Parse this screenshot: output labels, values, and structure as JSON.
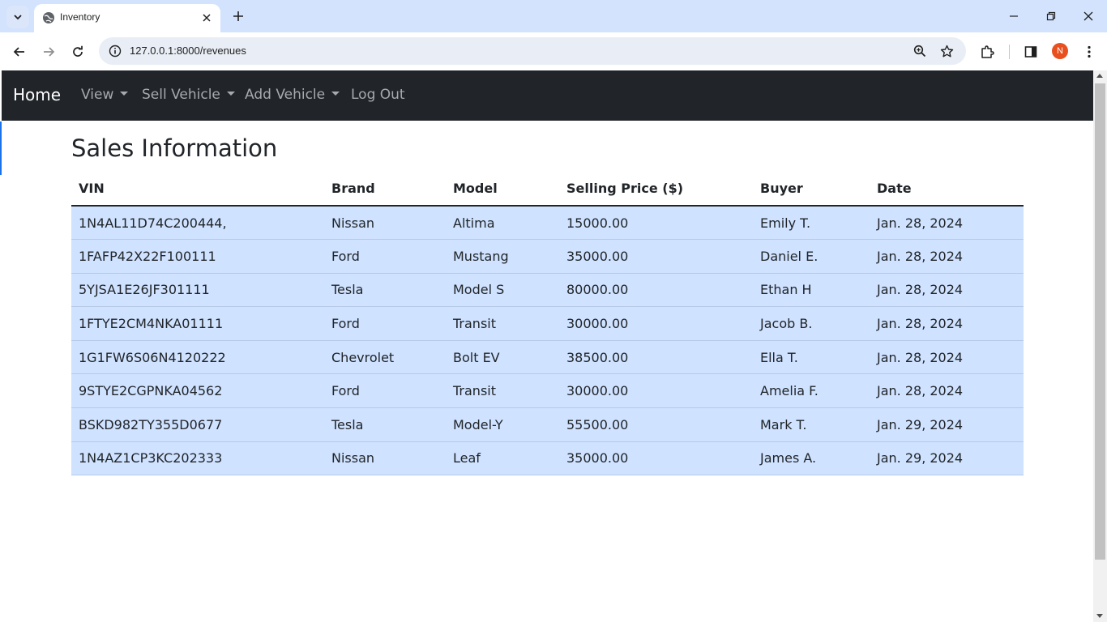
{
  "browser": {
    "tab_title": "Inventory",
    "url": "127.0.0.1:8000/revenues",
    "profile_initial": "N"
  },
  "navbar": {
    "brand": "Home",
    "items": [
      {
        "label": "View",
        "dropdown": true
      },
      {
        "label": "Sell Vehicle",
        "dropdown": true
      },
      {
        "label": "Add Vehicle",
        "dropdown": true
      },
      {
        "label": "Log Out",
        "dropdown": false
      }
    ]
  },
  "page": {
    "title": "Sales Information"
  },
  "table": {
    "headers": [
      "VIN",
      "Brand",
      "Model",
      "Selling Price ($)",
      "Buyer",
      "Date"
    ],
    "rows": [
      [
        "1N4AL11D74C200444,",
        "Nissan",
        "Altima",
        "15000.00",
        "Emily T.",
        "Jan. 28, 2024"
      ],
      [
        "1FAFP42X22F100111",
        "Ford",
        "Mustang",
        "35000.00",
        "Daniel E.",
        "Jan. 28, 2024"
      ],
      [
        "5YJSA1E26JF301111",
        "Tesla",
        "Model S",
        "80000.00",
        "Ethan H",
        "Jan. 28, 2024"
      ],
      [
        "1FTYE2CM4NKA01111",
        "Ford",
        "Transit",
        "30000.00",
        "Jacob B.",
        "Jan. 28, 2024"
      ],
      [
        "1G1FW6S06N4120222",
        "Chevrolet",
        "Bolt EV",
        "38500.00",
        "Ella T.",
        "Jan. 28, 2024"
      ],
      [
        "9STYE2CGPNKA04562",
        "Ford",
        "Transit",
        "30000.00",
        "Amelia F.",
        "Jan. 28, 2024"
      ],
      [
        "BSKD982TY355D0677",
        "Tesla",
        "Model-Y",
        "55500.00",
        "Mark T.",
        "Jan. 29, 2024"
      ],
      [
        "1N4AZ1CP3KC202333",
        "Nissan",
        "Leaf",
        "35000.00",
        "James A.",
        "Jan. 29, 2024"
      ]
    ]
  },
  "colors": {
    "navbar_bg": "#212529",
    "row_bg": "#cfe2ff",
    "tabstrip_bg": "#d3e3fd"
  }
}
